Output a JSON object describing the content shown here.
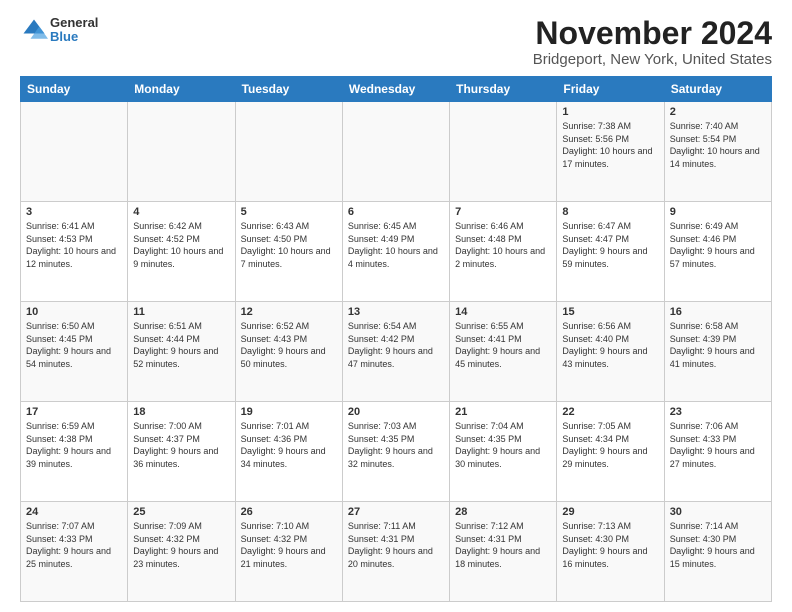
{
  "logo": {
    "general": "General",
    "blue": "Blue"
  },
  "title": "November 2024",
  "subtitle": "Bridgeport, New York, United States",
  "headers": [
    "Sunday",
    "Monday",
    "Tuesday",
    "Wednesday",
    "Thursday",
    "Friday",
    "Saturday"
  ],
  "weeks": [
    [
      {
        "day": "",
        "info": ""
      },
      {
        "day": "",
        "info": ""
      },
      {
        "day": "",
        "info": ""
      },
      {
        "day": "",
        "info": ""
      },
      {
        "day": "",
        "info": ""
      },
      {
        "day": "1",
        "info": "Sunrise: 7:38 AM\nSunset: 5:56 PM\nDaylight: 10 hours and 17 minutes."
      },
      {
        "day": "2",
        "info": "Sunrise: 7:40 AM\nSunset: 5:54 PM\nDaylight: 10 hours and 14 minutes."
      }
    ],
    [
      {
        "day": "3",
        "info": "Sunrise: 6:41 AM\nSunset: 4:53 PM\nDaylight: 10 hours and 12 minutes."
      },
      {
        "day": "4",
        "info": "Sunrise: 6:42 AM\nSunset: 4:52 PM\nDaylight: 10 hours and 9 minutes."
      },
      {
        "day": "5",
        "info": "Sunrise: 6:43 AM\nSunset: 4:50 PM\nDaylight: 10 hours and 7 minutes."
      },
      {
        "day": "6",
        "info": "Sunrise: 6:45 AM\nSunset: 4:49 PM\nDaylight: 10 hours and 4 minutes."
      },
      {
        "day": "7",
        "info": "Sunrise: 6:46 AM\nSunset: 4:48 PM\nDaylight: 10 hours and 2 minutes."
      },
      {
        "day": "8",
        "info": "Sunrise: 6:47 AM\nSunset: 4:47 PM\nDaylight: 9 hours and 59 minutes."
      },
      {
        "day": "9",
        "info": "Sunrise: 6:49 AM\nSunset: 4:46 PM\nDaylight: 9 hours and 57 minutes."
      }
    ],
    [
      {
        "day": "10",
        "info": "Sunrise: 6:50 AM\nSunset: 4:45 PM\nDaylight: 9 hours and 54 minutes."
      },
      {
        "day": "11",
        "info": "Sunrise: 6:51 AM\nSunset: 4:44 PM\nDaylight: 9 hours and 52 minutes."
      },
      {
        "day": "12",
        "info": "Sunrise: 6:52 AM\nSunset: 4:43 PM\nDaylight: 9 hours and 50 minutes."
      },
      {
        "day": "13",
        "info": "Sunrise: 6:54 AM\nSunset: 4:42 PM\nDaylight: 9 hours and 47 minutes."
      },
      {
        "day": "14",
        "info": "Sunrise: 6:55 AM\nSunset: 4:41 PM\nDaylight: 9 hours and 45 minutes."
      },
      {
        "day": "15",
        "info": "Sunrise: 6:56 AM\nSunset: 4:40 PM\nDaylight: 9 hours and 43 minutes."
      },
      {
        "day": "16",
        "info": "Sunrise: 6:58 AM\nSunset: 4:39 PM\nDaylight: 9 hours and 41 minutes."
      }
    ],
    [
      {
        "day": "17",
        "info": "Sunrise: 6:59 AM\nSunset: 4:38 PM\nDaylight: 9 hours and 39 minutes."
      },
      {
        "day": "18",
        "info": "Sunrise: 7:00 AM\nSunset: 4:37 PM\nDaylight: 9 hours and 36 minutes."
      },
      {
        "day": "19",
        "info": "Sunrise: 7:01 AM\nSunset: 4:36 PM\nDaylight: 9 hours and 34 minutes."
      },
      {
        "day": "20",
        "info": "Sunrise: 7:03 AM\nSunset: 4:35 PM\nDaylight: 9 hours and 32 minutes."
      },
      {
        "day": "21",
        "info": "Sunrise: 7:04 AM\nSunset: 4:35 PM\nDaylight: 9 hours and 30 minutes."
      },
      {
        "day": "22",
        "info": "Sunrise: 7:05 AM\nSunset: 4:34 PM\nDaylight: 9 hours and 29 minutes."
      },
      {
        "day": "23",
        "info": "Sunrise: 7:06 AM\nSunset: 4:33 PM\nDaylight: 9 hours and 27 minutes."
      }
    ],
    [
      {
        "day": "24",
        "info": "Sunrise: 7:07 AM\nSunset: 4:33 PM\nDaylight: 9 hours and 25 minutes."
      },
      {
        "day": "25",
        "info": "Sunrise: 7:09 AM\nSunset: 4:32 PM\nDaylight: 9 hours and 23 minutes."
      },
      {
        "day": "26",
        "info": "Sunrise: 7:10 AM\nSunset: 4:32 PM\nDaylight: 9 hours and 21 minutes."
      },
      {
        "day": "27",
        "info": "Sunrise: 7:11 AM\nSunset: 4:31 PM\nDaylight: 9 hours and 20 minutes."
      },
      {
        "day": "28",
        "info": "Sunrise: 7:12 AM\nSunset: 4:31 PM\nDaylight: 9 hours and 18 minutes."
      },
      {
        "day": "29",
        "info": "Sunrise: 7:13 AM\nSunset: 4:30 PM\nDaylight: 9 hours and 16 minutes."
      },
      {
        "day": "30",
        "info": "Sunrise: 7:14 AM\nSunset: 4:30 PM\nDaylight: 9 hours and 15 minutes."
      }
    ]
  ]
}
